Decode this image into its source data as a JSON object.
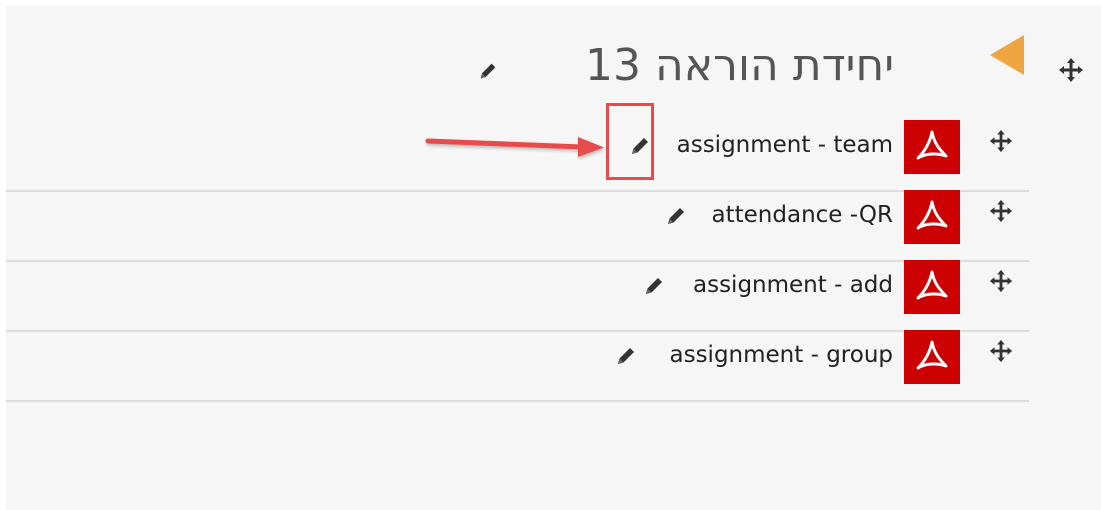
{
  "section": {
    "title": "יחידת הוראה 13"
  },
  "activities": [
    {
      "name": "assignment - team",
      "type": "pdf-icon"
    },
    {
      "name": "attendance -QR",
      "type": "pdf-icon"
    },
    {
      "name": "assignment - add",
      "type": "pdf-icon"
    },
    {
      "name": "assignment - group",
      "type": "pdf-icon"
    }
  ],
  "colors": {
    "accent": "#f0a640",
    "pdf": "#cc0000",
    "annotation": "#e84b4b",
    "background": "#f6f6f6"
  },
  "icons": [
    "move-icon",
    "pdf-icon",
    "pencil-icon",
    "collapse-arrow-icon"
  ]
}
